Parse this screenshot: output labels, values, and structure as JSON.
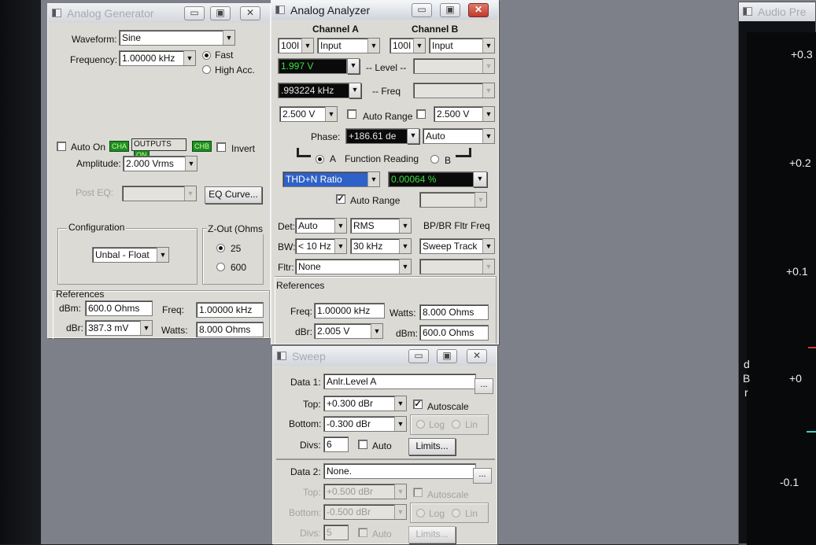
{
  "gen": {
    "title": "Analog Generator",
    "waveform_label": "Waveform:",
    "waveform": "Sine",
    "frequency_label": "Frequency:",
    "frequency": "1.00000 kHz",
    "fast": "Fast",
    "high_acc": "High Acc.",
    "auto_on": "Auto On",
    "cha": "CHA",
    "outputs": "OUTPUTS",
    "on": "ON",
    "chb": "CHB",
    "invert": "Invert",
    "amplitude_label": "Amplitude:",
    "amplitude": "2.000   Vrms",
    "post_eq": "Post EQ:",
    "eq_curve": "EQ Curve...",
    "config_title": "Configuration",
    "config": "Unbal - Float",
    "zout_title": "Z-Out (Ohms",
    "z25": "25",
    "z600": "600",
    "refs_title": "References",
    "dbm_label": "dBm:",
    "dbm": "600.0    Ohms",
    "freq_label": "Freq:",
    "freq": "1.00000 kHz",
    "dbr_label": "dBr:",
    "dbr": "387.3   mV",
    "watts_label": "Watts:",
    "watts": "8.000    Ohms"
  },
  "anlr": {
    "title": "Analog Analyzer",
    "ch_a": "Channel A",
    "ch_b": "Channel B",
    "range_a": "100I",
    "input_a": "Input",
    "range_b": "100I",
    "input_b": "Input",
    "level": "1.997   V",
    "level_label": "-- Level --",
    "freq": ".993224 kHz",
    "freq_label": "-- Freq",
    "vrange_a": "2.500   V",
    "auto_range": "Auto Range",
    "vrange_b": "2.500   V",
    "phase_label": "Phase:",
    "phase": "+186.61 de",
    "phase_mode": "Auto",
    "a": "A",
    "function_reading": "Function Reading",
    "b": "B",
    "function": "THD+N Ratio",
    "reading": "0.00064  %",
    "auto_range2": "Auto Range",
    "det_label": "Det:",
    "det": "Auto",
    "rms": "RMS",
    "bp_label": "BP/BR Fltr Freq",
    "bw_label": "BW:",
    "bw_low": "< 10 Hz",
    "bw_high": "30 kHz",
    "sweep_track": "Sweep Track",
    "fltr_label": "Fltr:",
    "fltr": "None",
    "refs_title": "References",
    "ref_freq_label": "Freq:",
    "ref_freq": "1.00000 kHz",
    "watts_label": "Watts:",
    "watts": "8.000     Ohms",
    "dbr_label": "dBr:",
    "dbr": "2.005    V",
    "dbm_label": "dBm:",
    "dbm": "600.0     Ohms"
  },
  "sweep": {
    "title": "Sweep",
    "data1_label": "Data 1:",
    "data1": "Anlr.Level A",
    "top_label": "Top:",
    "top1": "+0.300   dBr",
    "autoscale": "Autoscale",
    "bottom_label": "Bottom:",
    "bottom1": "-0.300   dBr",
    "log": "Log",
    "lin": "Lin",
    "divs_label": "Divs:",
    "divs1": "6",
    "auto": "Auto",
    "limits": "Limits...",
    "data2_label": "Data 2:",
    "data2": "None.",
    "top2": "+0.500   dBr",
    "bottom2": "-0.500   dBr",
    "divs2": "5",
    "ellipsis": "..."
  },
  "plot": {
    "title": "Audio Pre",
    "ticks": [
      "+0.3",
      "+0.2",
      "+0.1",
      "+0",
      "-0.1"
    ],
    "axis_label": [
      "d",
      "B",
      "r"
    ]
  }
}
